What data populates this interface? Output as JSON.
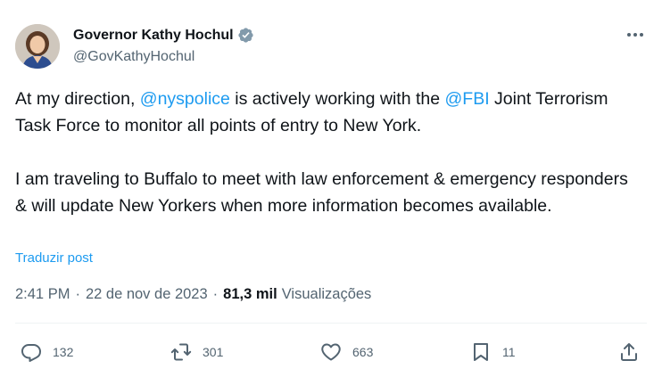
{
  "author": {
    "display_name": "Governor Kathy Hochul",
    "handle": "@GovKathyHochul",
    "avatar_icon": "profile-photo",
    "verified_icon": "verified-badge-icon",
    "verified_color": "#829aab"
  },
  "tweet": {
    "p1_before": "At my direction, ",
    "mention_1": "@nyspolice",
    "p1_middle": " is actively working with the ",
    "mention_2": "@FBI",
    "p1_after": " Joint Terrorism Task Force to monitor all points of entry to New York.",
    "p2": "I am traveling to Buffalo to meet with law enforcement & emergency responders & will update New Yorkers when more information becomes available.",
    "translate_label": "Traduzir post"
  },
  "meta": {
    "time": "2:41 PM",
    "separator": "·",
    "date": "22 de nov de 2023",
    "views_count": "81,3 mil",
    "views_label": "Visualizações"
  },
  "actions": {
    "replies": "132",
    "reposts": "301",
    "likes": "663",
    "bookmarks": "11"
  },
  "colors": {
    "link": "#1d9bf0",
    "secondary_text": "#536471",
    "primary_text": "#0f1419"
  }
}
